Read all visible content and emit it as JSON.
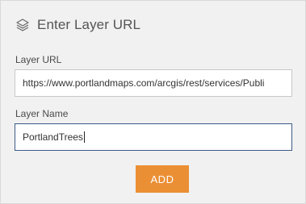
{
  "header": {
    "icon": "layers-icon",
    "title": "Enter Layer URL"
  },
  "layer_url": {
    "label": "Layer URL",
    "value": "https://www.portlandmaps.com/arcgis/rest/services/Publi"
  },
  "layer_name": {
    "label": "Layer Name",
    "value": "PortlandTrees"
  },
  "actions": {
    "add_label": "ADD"
  },
  "colors": {
    "panel_bg": "#f1f1f1",
    "add_button": "#eb8f35",
    "focus_border": "#3b5a87"
  }
}
